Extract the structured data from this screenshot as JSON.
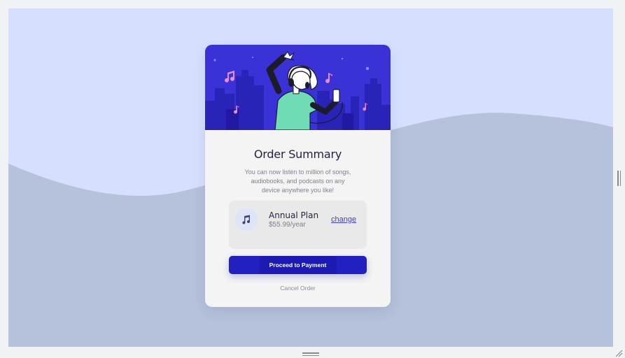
{
  "card": {
    "title": "Order Summary",
    "description": "You can now listen to million of songs, audiobooks, and podcasts on any device anywhere you like!",
    "plan": {
      "name": "Annual Plan",
      "price": "$55.99/year",
      "change_label": "change",
      "icon": "music-note-icon"
    },
    "proceed_label": "Proceed to Payment",
    "cancel_label": "Cancel Order"
  },
  "colors": {
    "background": "#d6e0fe",
    "wave": "#b6c2db",
    "hero": "#3a31d6",
    "primary_button": "#2320c2",
    "link": "#3b3fd6"
  }
}
